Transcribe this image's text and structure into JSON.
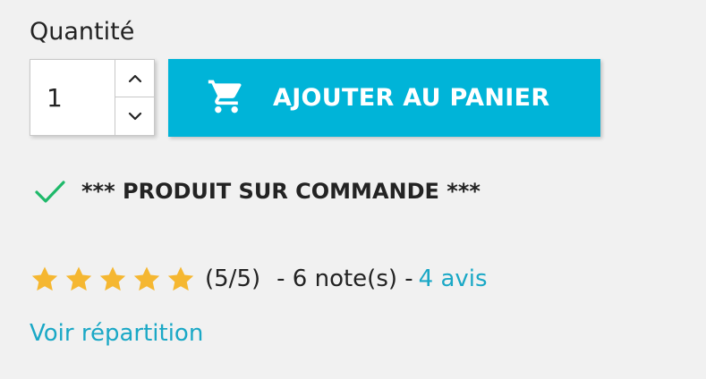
{
  "quantity": {
    "label": "Quantité",
    "value": "1",
    "increment_icon": "chevron-up-icon",
    "decrement_icon": "chevron-down-icon"
  },
  "cart_button": {
    "label": "AJOUTER AU PANIER",
    "icon": "shopping-cart-icon",
    "color": "#00b4d8"
  },
  "availability": {
    "icon": "checkmark-icon",
    "icon_color": "#1fb96a",
    "text": "*** PRODUIT SUR COMMANDE ***"
  },
  "rating": {
    "stars_filled": 5,
    "stars_total": 5,
    "star_color": "#f5b731",
    "score_text": "(5/5)",
    "notes_text": "- 6 note(s) -",
    "reviews_link": "4 avis",
    "link_color": "#1aa8c6"
  },
  "distribution_link": "Voir répartition"
}
